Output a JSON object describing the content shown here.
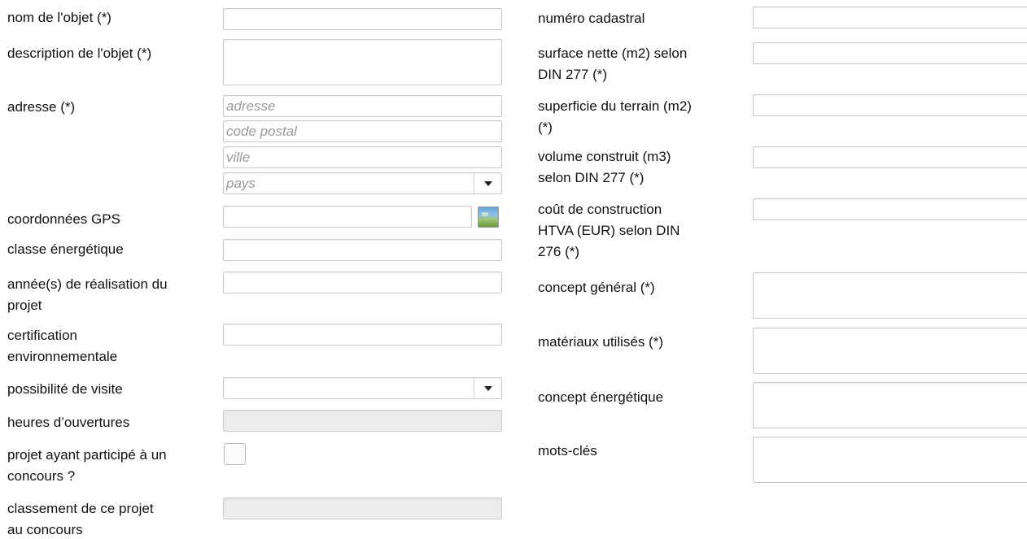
{
  "left": {
    "nom_label": "nom de l'objet (*)",
    "description_label": "description de l'objet (*)",
    "adresse_label": "adresse (*)",
    "adresse_placeholder": "adresse",
    "code_postal_placeholder": "code postal",
    "ville_placeholder": "ville",
    "pays_placeholder": "pays",
    "gps_label": "coordonnées GPS",
    "gps_button_icon": "map-icon",
    "classe_label": "classe énergétique",
    "annee_label_1": "année(s) de réalisation du",
    "annee_label_2": "projet",
    "certification_label_1": "certification",
    "certification_label_2": "environnementale",
    "visite_label": "possibilité de visite",
    "heures_label": "heures d’ouvertures",
    "concours_label_1": "projet ayant participé à un",
    "concours_label_2": "concours ?",
    "classement_label_1": "classement de ce projet",
    "classement_label_2": "au concours"
  },
  "right": {
    "cadastral_label": "numéro cadastral",
    "surface_label_1": "surface nette (m2) selon",
    "surface_label_2": "DIN 277 (*)",
    "superficie_label_1": "superficie du terrain (m2)",
    "superficie_label_2": "(*)",
    "volume_label_1": "volume construit (m3)",
    "volume_label_2": "selon DIN 277 (*)",
    "cout_label_1": "coût de construction",
    "cout_label_2": "HTVA (EUR) selon DIN",
    "cout_label_3": "276 (*)",
    "concept_general_label": "concept général (*)",
    "materiaux_label": "matériaux utilisés (*)",
    "concept_energetique_label": "concept énergétique",
    "mots_cles_label": "mots-clés"
  }
}
